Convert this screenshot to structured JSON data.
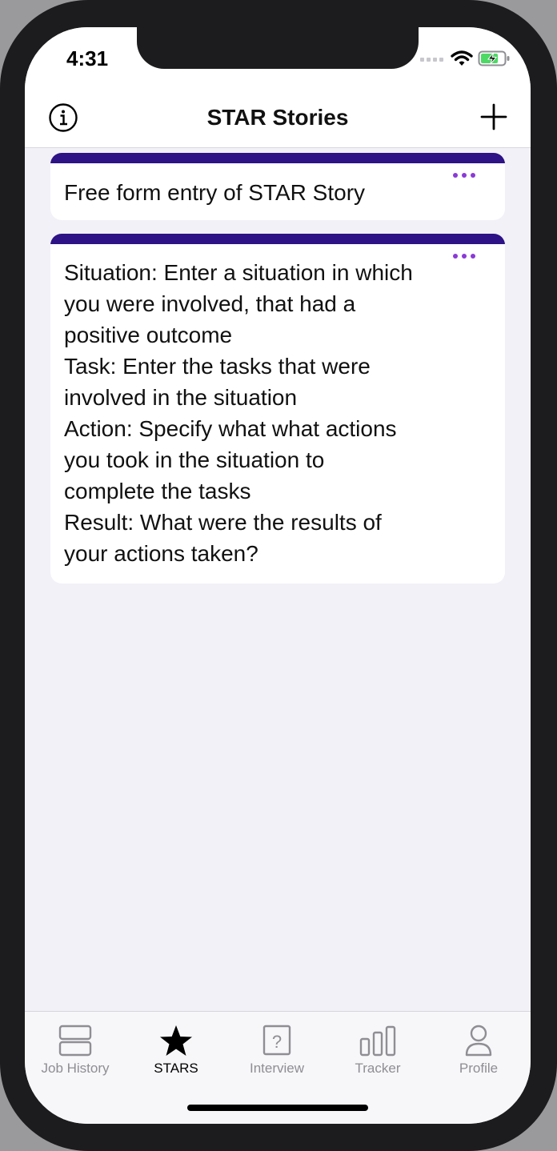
{
  "status": {
    "time": "4:31"
  },
  "header": {
    "title": "STAR Stories"
  },
  "cards": [
    {
      "text": "Free form entry of STAR Story"
    },
    {
      "text": "Situation: Enter a situation in which you were involved, that had a positive outcome\nTask: Enter the tasks that were involved in the situation\nAction: Specify what what actions you took in the situation to complete the tasks\nResult: What were the results of your actions taken?"
    }
  ],
  "tabs": [
    {
      "label": "Job History",
      "icon": "stack-icon",
      "active": false
    },
    {
      "label": "STARS",
      "icon": "star-icon",
      "active": true
    },
    {
      "label": "Interview",
      "icon": "question-icon",
      "active": false
    },
    {
      "label": "Tracker",
      "icon": "bars-icon",
      "active": false
    },
    {
      "label": "Profile",
      "icon": "person-icon",
      "active": false
    }
  ],
  "colors": {
    "card_bar": "#2d1385",
    "accent_dots": "#8a3ad6",
    "tab_inactive": "#8e8e93"
  }
}
